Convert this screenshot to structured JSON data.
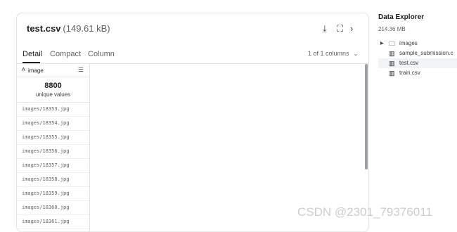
{
  "file": {
    "name": "test.csv",
    "size": "(149.61 kB)"
  },
  "header_icons": {
    "download": "download-icon",
    "fullscreen": "fullscreen-icon",
    "next": "chevron-right-icon"
  },
  "tabs": [
    {
      "label": "Detail",
      "active": true
    },
    {
      "label": "Compact",
      "active": false
    },
    {
      "label": "Column",
      "active": false
    }
  ],
  "column_count": "1 of 1 columns",
  "column": {
    "type_icon": "A",
    "name": "image",
    "unique_count": "8800",
    "unique_label": "unique values",
    "rows": [
      "images/18353.jpg",
      "images/18354.jpg",
      "images/18355.jpg",
      "images/18356.jpg",
      "images/18357.jpg",
      "images/18358.jpg",
      "images/18359.jpg",
      "images/18360.jpg",
      "images/18361.jpg"
    ]
  },
  "explorer": {
    "title": "Data Explorer",
    "size": "214.36 MB",
    "items": [
      {
        "label": "images",
        "icon": "folder-icon",
        "has_arrow": true,
        "selected": false
      },
      {
        "label": "sample_submission.c",
        "icon": "table-icon",
        "has_arrow": false,
        "selected": false
      },
      {
        "label": "test.csv",
        "icon": "table-icon",
        "has_arrow": false,
        "selected": true
      },
      {
        "label": "train.csv",
        "icon": "table-icon",
        "has_arrow": false,
        "selected": false
      }
    ]
  },
  "watermark": "CSDN @2301_79376011",
  "colors": {
    "accent": "#202124",
    "border": "#e2e3e5",
    "scrollbar": "#9aa0a6",
    "selected_bg": "#f1f3f4"
  }
}
